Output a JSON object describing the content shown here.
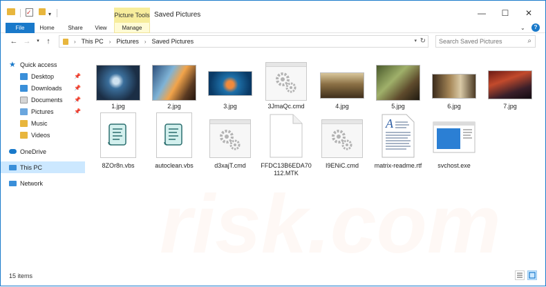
{
  "window": {
    "title": "Saved Pictures",
    "contextual_tab": "Picture Tools",
    "minimize_glyph": "—",
    "maximize_glyph": "☐",
    "close_glyph": "✕"
  },
  "ribbon": {
    "tabs": [
      "File",
      "Home",
      "Share",
      "View",
      "Manage"
    ],
    "expand_glyph": "⌄",
    "help_glyph": "?"
  },
  "address": {
    "crumbs": [
      "This PC",
      "Pictures",
      "Saved Pictures"
    ],
    "separator": "›"
  },
  "search": {
    "placeholder": "Search Saved Pictures"
  },
  "nav": {
    "quick_access": "Quick access",
    "items": [
      "Desktop",
      "Downloads",
      "Documents",
      "Pictures",
      "Music",
      "Videos"
    ],
    "onedrive": "OneDrive",
    "this_pc": "This PC",
    "network": "Network"
  },
  "files": [
    {
      "name": "1.jpg",
      "kind": "photo"
    },
    {
      "name": "2.jpg",
      "kind": "photo"
    },
    {
      "name": "3.jpg",
      "kind": "photo"
    },
    {
      "name": "3JmaQc.cmd",
      "kind": "cmd"
    },
    {
      "name": "4.jpg",
      "kind": "photo"
    },
    {
      "name": "5.jpg",
      "kind": "photo"
    },
    {
      "name": "6.jpg",
      "kind": "photo"
    },
    {
      "name": "7.jpg",
      "kind": "photo"
    },
    {
      "name": "8ZOr8n.vbs",
      "kind": "vbs"
    },
    {
      "name": "autoclean.vbs",
      "kind": "vbs"
    },
    {
      "name": "d3xajT.cmd",
      "kind": "cmd"
    },
    {
      "name": "FFDC13B6EDA70112.MTK",
      "kind": "blank"
    },
    {
      "name": "I9ENiC.cmd",
      "kind": "cmd"
    },
    {
      "name": "matrix-readme.rtf",
      "kind": "rtf"
    },
    {
      "name": "svchost.exe",
      "kind": "exe"
    }
  ],
  "status": {
    "count_text": "15 items"
  },
  "colors": {
    "accent": "#1979ca",
    "folder": "#e8b63d",
    "selection": "#cce8ff",
    "context_tab": "#f7ed9c"
  },
  "watermark": "risk.com"
}
